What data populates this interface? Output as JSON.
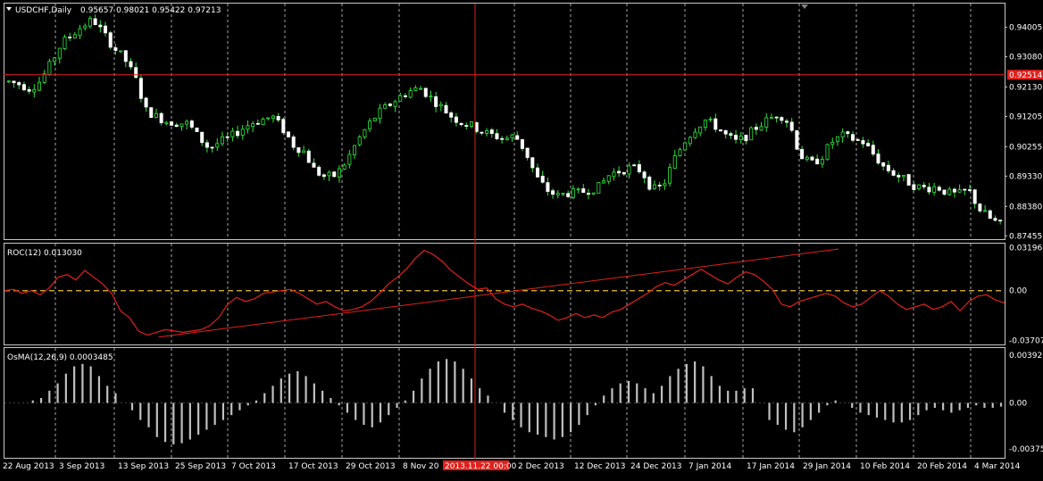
{
  "chart_data": [
    {
      "type": "candlestick",
      "symbol_label": "USDCHF,Daily",
      "ohlc_label": "0.95657 0.98021 0.95422 0.97213",
      "y_ticks": [
        "0.94005",
        "0.93080",
        "0.92130",
        "0.91205",
        "0.90255",
        "0.89330",
        "0.88380",
        "0.87455"
      ],
      "ylim": [
        0.8735,
        0.9475
      ],
      "hline_value": 0.92514,
      "hline_label": "0.92514",
      "x_ticks": [
        "22 Aug 2013",
        "3 Sep 2013",
        "13 Sep 2013",
        "25 Sep 2013",
        "7 Oct 2013",
        "17 Oct 2013",
        "29 Oct 2013",
        "8 Nov 20",
        "2 Dec 2013",
        "12 Dec 2013",
        "24 Dec 2013",
        "7 Jan 2014",
        "17 Jan 2014",
        "29 Jan 2014",
        "10 Feb 2014",
        "20 Feb 2014",
        "4 Mar 2014"
      ],
      "crosshair_label": "2013.11.22 00:00",
      "close_path": [
        0.923,
        0.9222,
        0.9208,
        0.9232,
        0.9288,
        0.935,
        0.9378,
        0.9405,
        0.9425,
        0.938,
        0.9335,
        0.93,
        0.924,
        0.914,
        0.912,
        0.9105,
        0.91,
        0.9098,
        0.9055,
        0.902,
        0.904,
        0.9055,
        0.908,
        0.91,
        0.911,
        0.912,
        0.908,
        0.903,
        0.901,
        0.895,
        0.893,
        0.8935,
        0.898,
        0.904,
        0.909,
        0.913,
        0.9155,
        0.918,
        0.92,
        0.921,
        0.918,
        0.915,
        0.912,
        0.91,
        0.909,
        0.907,
        0.906,
        0.905,
        0.906,
        0.901,
        0.893,
        0.889,
        0.887,
        0.888,
        0.888,
        0.889,
        0.89,
        0.894,
        0.895,
        0.896,
        0.895,
        0.889,
        0.89,
        0.898,
        0.904,
        0.908,
        0.911,
        0.909,
        0.906,
        0.904,
        0.906,
        0.909,
        0.911,
        0.913,
        0.91,
        0.9,
        0.897,
        0.899,
        0.904,
        0.906,
        0.905,
        0.904,
        0.9,
        0.896,
        0.894,
        0.892,
        0.89,
        0.8895,
        0.89,
        0.888,
        0.8875,
        0.889,
        0.883,
        0.88,
        0.878
      ],
      "candle_count": 196
    },
    {
      "type": "line",
      "label": "ROC(12) 0.013030",
      "y_ticks": [
        "0.031968",
        "0.00",
        "-0.037079"
      ],
      "ylim": [
        -0.04,
        0.035
      ],
      "zero_line_color": "#e8c020",
      "series": [
        {
          "color": "#e0201c",
          "values": [
            0.0,
            0.001,
            -0.002,
            0.0,
            -0.003,
            0.002,
            0.01,
            0.012,
            0.008,
            0.015,
            0.01,
            0.005,
            -0.002,
            -0.015,
            -0.02,
            -0.03,
            -0.033,
            -0.031,
            -0.029,
            -0.03,
            -0.031,
            -0.03,
            -0.029,
            -0.026,
            -0.02,
            -0.01,
            -0.005,
            -0.008,
            -0.006,
            -0.002,
            -0.001,
            0.0,
            0.001,
            -0.002,
            -0.006,
            -0.01,
            -0.008,
            -0.012,
            -0.015,
            -0.014,
            -0.012,
            -0.008,
            -0.002,
            0.005,
            0.01,
            0.016,
            0.024,
            0.03,
            0.027,
            0.022,
            0.015,
            0.01,
            0.005,
            0.001,
            0.002,
            -0.006,
            -0.01,
            -0.012,
            -0.01,
            -0.013,
            -0.015,
            -0.018,
            -0.022,
            -0.02,
            -0.017,
            -0.02,
            -0.018,
            -0.02,
            -0.016,
            -0.014,
            -0.01,
            -0.006,
            -0.002,
            0.003,
            0.006,
            0.004,
            0.008,
            0.012,
            0.016,
            0.012,
            0.008,
            0.005,
            0.01,
            0.014,
            0.012,
            0.007,
            0.001,
            -0.01,
            -0.012,
            -0.008,
            -0.006,
            -0.004,
            -0.002,
            -0.004,
            -0.009,
            -0.012,
            -0.01,
            -0.005,
            0.0,
            -0.004,
            -0.01,
            -0.014,
            -0.012,
            -0.01,
            -0.014,
            -0.012,
            -0.008,
            -0.015,
            -0.008,
            -0.004,
            -0.003,
            -0.007,
            -0.009
          ]
        }
      ],
      "trendlines": [
        {
          "x": [
            0.154,
            0.834
          ],
          "y": [
            -0.0345,
            0.031
          ],
          "color": "#e0201c"
        }
      ]
    },
    {
      "type": "bar",
      "label": "OsMA(12,26,9) 0.0003485",
      "y_ticks": [
        "0.003926",
        "0.00",
        "-0.003759"
      ],
      "ylim": [
        -0.0045,
        0.0045
      ],
      "bar_color": "#c0c0c0",
      "values": [
        0.0,
        0.0,
        0.0,
        0.0002,
        0.0004,
        0.001,
        0.0016,
        0.0024,
        0.003,
        0.0032,
        0.003,
        0.0022,
        0.0014,
        0.0008,
        0.0,
        -0.0006,
        -0.0014,
        -0.002,
        -0.0028,
        -0.0032,
        -0.0034,
        -0.0033,
        -0.003,
        -0.0026,
        -0.0022,
        -0.0018,
        -0.0014,
        -0.001,
        -0.0006,
        -0.0002,
        0.0002,
        0.0008,
        0.0014,
        0.002,
        0.0024,
        0.0026,
        0.0022,
        0.0016,
        0.001,
        0.0004,
        -0.0002,
        -0.0008,
        -0.0014,
        -0.0018,
        -0.002,
        -0.0016,
        -0.001,
        -0.0004,
        0.0002,
        0.001,
        0.002,
        0.0028,
        0.0034,
        0.0036,
        0.0034,
        0.0028,
        0.002,
        0.0012,
        0.0006,
        0.0,
        -0.0008,
        -0.0014,
        -0.002,
        -0.0024,
        -0.0026,
        -0.0028,
        -0.003,
        -0.0028,
        -0.0024,
        -0.0018,
        -0.001,
        -0.0002,
        0.0006,
        0.0012,
        0.0016,
        0.0018,
        0.0016,
        0.0012,
        0.0008,
        0.0014,
        0.0022,
        0.0028,
        0.0032,
        0.0034,
        0.003,
        0.0022,
        0.0014,
        0.001,
        0.001,
        0.0012,
        0.0012,
        0.0,
        -0.0014,
        -0.0018,
        -0.0022,
        -0.0024,
        -0.002,
        -0.0014,
        -0.0008,
        -0.0002,
        0.0002,
        0.0,
        -0.0004,
        -0.0008,
        -0.001,
        -0.0012,
        -0.0014,
        -0.0016,
        -0.0016,
        -0.0014,
        -0.001,
        -0.0006,
        -0.0004,
        -0.0006,
        -0.0008,
        -0.0006,
        -0.0004,
        -0.0002,
        -0.0004,
        -0.0004,
        -0.0003
      ]
    }
  ]
}
